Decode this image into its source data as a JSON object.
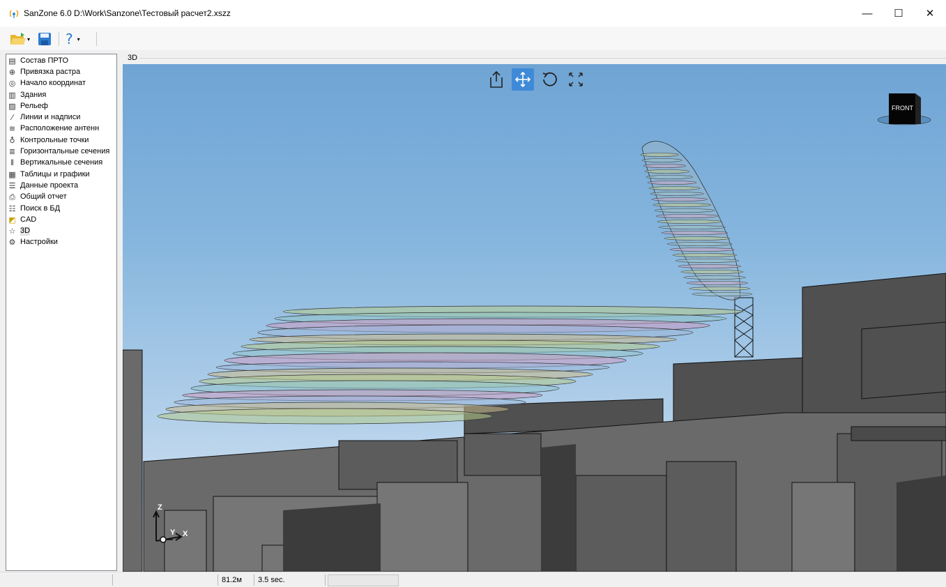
{
  "window": {
    "title": "SanZone 6.0 D:\\Work\\Sanzone\\Тестовый расчет2.xszz",
    "minimize_glyph": "—",
    "maximize_glyph": "☐",
    "close_glyph": "✕"
  },
  "toolbar": {
    "help_label": "?",
    "dropdown_glyph": "▾"
  },
  "sidebar": {
    "items": [
      {
        "label": "Состав ПРТО",
        "icon": "composition-icon"
      },
      {
        "label": "Привязка растра",
        "icon": "raster-binding-icon"
      },
      {
        "label": "Начало координат",
        "icon": "origin-pin-icon"
      },
      {
        "label": "Здания",
        "icon": "buildings-icon"
      },
      {
        "label": "Рельеф",
        "icon": "relief-icon"
      },
      {
        "label": "Линии и надписи",
        "icon": "lines-icon"
      },
      {
        "label": "Расположение антенн",
        "icon": "antenna-icon"
      },
      {
        "label": "Контрольные точки",
        "icon": "control-points-icon"
      },
      {
        "label": "Горизонтальные сечения",
        "icon": "horizontal-sections-icon"
      },
      {
        "label": "Вертикальные сечения",
        "icon": "vertical-sections-icon"
      },
      {
        "label": "Таблицы и графики",
        "icon": "table-icon"
      },
      {
        "label": "Данные проекта",
        "icon": "list-icon"
      },
      {
        "label": "Общий отчет",
        "icon": "printer-icon"
      },
      {
        "label": "Поиск в БД",
        "icon": "database-icon"
      },
      {
        "label": "CAD",
        "icon": "cad-icon"
      },
      {
        "label": "3D",
        "icon": "3d-icon",
        "selected": true
      },
      {
        "label": "Настройки",
        "icon": "gear-icon"
      }
    ]
  },
  "view": {
    "tab_label": "3D",
    "cube_label": "FRONT",
    "axis_z": "Z",
    "axis_y": "Y",
    "axis_x": "X"
  },
  "status": {
    "distance": "81.2м",
    "time": "3.5 sec."
  },
  "colors": {
    "accent": "#3f8ad7",
    "sky_top": "#6fa4d4",
    "sky_bottom": "#dfeaf4",
    "building": "#5a5a5a"
  }
}
